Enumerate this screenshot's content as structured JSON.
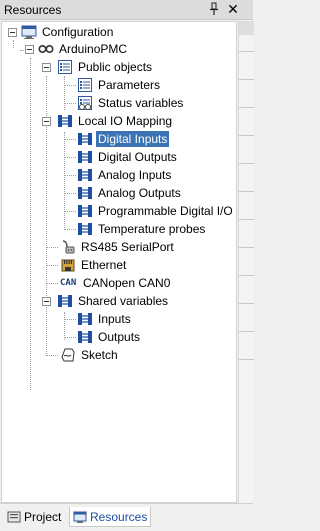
{
  "panel": {
    "title": "Resources",
    "pin_icon": "pin-icon",
    "close_icon": "close-icon"
  },
  "tree": {
    "configuration": "Configuration",
    "device": "ArduinoPMC",
    "public_objects": "Public objects",
    "parameters": "Parameters",
    "status_variables": "Status variables",
    "local_io_mapping": "Local IO Mapping",
    "digital_inputs": "Digital Inputs",
    "digital_outputs": "Digital Outputs",
    "analog_inputs": "Analog Inputs",
    "analog_outputs": "Analog Outputs",
    "programmable_digital_io": "Programmable Digital I/O",
    "temperature_probes": "Temperature probes",
    "rs485": "RS485 SerialPort",
    "ethernet": "Ethernet",
    "canopen": "CANopen CAN0",
    "shared_variables": "Shared variables",
    "inputs": "Inputs",
    "outputs": "Outputs",
    "sketch": "Sketch",
    "can_icon_text": "CAN"
  },
  "tabs": [
    {
      "label": "Project",
      "icon": "project-icon"
    },
    {
      "label": "Resources",
      "icon": "resources-icon"
    }
  ],
  "colors": {
    "selection": "#3c73b4",
    "icon_blue": "#1e4fa0"
  }
}
